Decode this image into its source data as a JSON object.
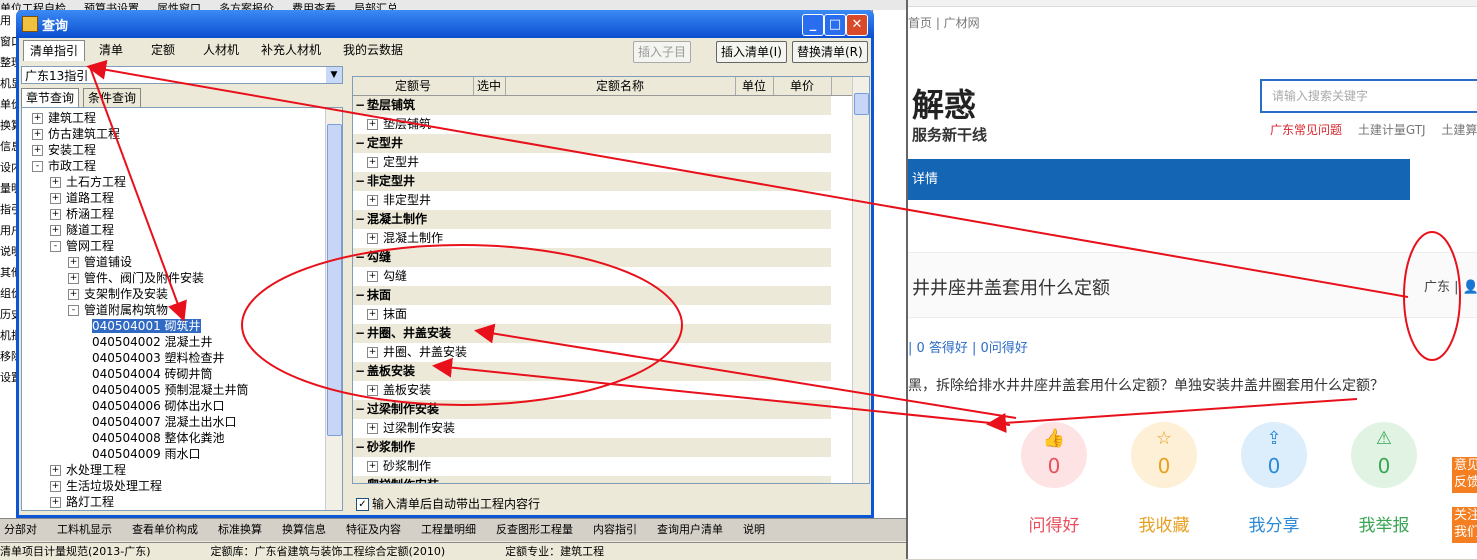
{
  "bg_app": {
    "toolbar_items": [
      "单位工程自检",
      "预算书设置",
      "属性窗口",
      "多方案报价",
      "费用查看",
      "局部汇总"
    ],
    "left_col_chars": [
      "用",
      "窗口",
      "整理",
      "机显",
      "单价",
      "换算",
      "信息",
      "设内",
      "量明",
      "指引",
      "用户",
      "说明",
      "其他",
      "组价",
      "历史",
      "机批",
      "移除",
      "设置"
    ],
    "bottom_tabs": [
      "分部对",
      "工料机显示",
      "查看单价构成",
      "标准换算",
      "换算信息",
      "特征及内容",
      "工程量明细",
      "反查图形工程量",
      "内容指引",
      "查询用户清单",
      "说明"
    ],
    "status": [
      "清单项目计量规范(2013-广东)",
      "定额库：广东省建筑与装饰工程综合定额(2010)",
      "定额专业：建筑工程"
    ]
  },
  "dialog": {
    "title": "查询",
    "tabs": [
      "清单指引",
      "清单",
      "定额",
      "人材机",
      "补充人材机",
      "我的云数据"
    ],
    "buttons": {
      "insert_child": "插入子目",
      "insert_list": "插入清单(I)",
      "replace_list": "替换清单(R)"
    },
    "select_value": "广东13指引",
    "subtabs": [
      "章节查询",
      "条件查询"
    ],
    "tree": [
      {
        "label": "建筑工程",
        "level": 0,
        "exp": "+"
      },
      {
        "label": "仿古建筑工程",
        "level": 0,
        "exp": "+"
      },
      {
        "label": "安装工程",
        "level": 0,
        "exp": "+"
      },
      {
        "label": "市政工程",
        "level": 0,
        "exp": "-"
      },
      {
        "label": "土石方工程",
        "level": 1,
        "exp": "+"
      },
      {
        "label": "道路工程",
        "level": 1,
        "exp": "+"
      },
      {
        "label": "桥涵工程",
        "level": 1,
        "exp": "+"
      },
      {
        "label": "隧道工程",
        "level": 1,
        "exp": "+"
      },
      {
        "label": "管网工程",
        "level": 1,
        "exp": "-"
      },
      {
        "label": "管道铺设",
        "level": 2,
        "exp": "+"
      },
      {
        "label": "管件、阀门及附件安装",
        "level": 2,
        "exp": "+"
      },
      {
        "label": "支架制作及安装",
        "level": 2,
        "exp": "+"
      },
      {
        "label": "管道附属构筑物",
        "level": 2,
        "exp": "-"
      },
      {
        "label": "040504001  砌筑井",
        "level": 3,
        "exp": "",
        "selected": true
      },
      {
        "label": "040504002  混凝土井",
        "level": 3,
        "exp": ""
      },
      {
        "label": "040504003  塑料检查井",
        "level": 3,
        "exp": ""
      },
      {
        "label": "040504004  砖砌井筒",
        "level": 3,
        "exp": ""
      },
      {
        "label": "040504005  预制混凝土井筒",
        "level": 3,
        "exp": ""
      },
      {
        "label": "040504006  砌体出水口",
        "level": 3,
        "exp": ""
      },
      {
        "label": "040504007  混凝土出水口",
        "level": 3,
        "exp": ""
      },
      {
        "label": "040504008  整体化粪池",
        "level": 3,
        "exp": ""
      },
      {
        "label": "040504009  雨水口",
        "level": 3,
        "exp": ""
      },
      {
        "label": "水处理工程",
        "level": 1,
        "exp": "+"
      },
      {
        "label": "生活垃圾处理工程",
        "level": 1,
        "exp": "+"
      },
      {
        "label": "路灯工程",
        "level": 1,
        "exp": "+"
      }
    ],
    "grid_headers": [
      "定额号",
      "选中",
      "定额名称",
      "单位",
      "单价"
    ],
    "grid_rows": [
      {
        "type": "group",
        "label": "垫层铺筑"
      },
      {
        "type": "child",
        "label": "垫层铺筑"
      },
      {
        "type": "group",
        "label": "定型井"
      },
      {
        "type": "child",
        "label": "定型井"
      },
      {
        "type": "group",
        "label": "非定型井"
      },
      {
        "type": "child",
        "label": "非定型井"
      },
      {
        "type": "group",
        "label": "混凝土制作"
      },
      {
        "type": "child",
        "label": "混凝土制作"
      },
      {
        "type": "group",
        "label": "勾缝"
      },
      {
        "type": "child",
        "label": "勾缝"
      },
      {
        "type": "group",
        "label": "抹面"
      },
      {
        "type": "child",
        "label": "抹面"
      },
      {
        "type": "group",
        "label": "井圈、井盖安装"
      },
      {
        "type": "child",
        "label": "井圈、井盖安装"
      },
      {
        "type": "group",
        "label": "盖板安装"
      },
      {
        "type": "child",
        "label": "盖板安装"
      },
      {
        "type": "group",
        "label": "过梁制作安装"
      },
      {
        "type": "child",
        "label": "过梁制作安装"
      },
      {
        "type": "group",
        "label": "砂浆制作"
      },
      {
        "type": "child",
        "label": "砂浆制作"
      },
      {
        "type": "group",
        "label": "爬梯制作安装"
      }
    ],
    "checkbox_label": "输入清单后自动带出工程内容行",
    "checkbox_checked": true
  },
  "web": {
    "breadcrumb": "首页  |  广材网",
    "logo_main": "解惑",
    "logo_sub": "服务新干线",
    "search_placeholder": "请输入搜索关键字",
    "hot_links": [
      "广东常见问题",
      "土建计量GTJ",
      "土建算"
    ],
    "nav_text": "详情",
    "question_title": "井井座井盖套用什么定额",
    "region": "广东",
    "stats": "| 0 答得好 | 0问得好",
    "question_text": "黑，拆除给排水井井座井盖套用什么定额？单独安装井盖井圈套用什么定额？",
    "actions": [
      {
        "label": "问得好",
        "count": "0",
        "icon": "thumbs-up",
        "color": "#e8505b",
        "bg": "#fde3e4"
      },
      {
        "label": "我收藏",
        "count": "0",
        "icon": "star",
        "color": "#e8a020",
        "bg": "#fdf0d6"
      },
      {
        "label": "我分享",
        "count": "0",
        "icon": "share",
        "color": "#2b8ad8",
        "bg": "#dcedfb"
      },
      {
        "label": "我举报",
        "count": "0",
        "icon": "warning",
        "color": "#3aa655",
        "bg": "#e1f4e4"
      }
    ],
    "side_tags": [
      "意见反馈",
      "关注我们"
    ]
  },
  "colors": {
    "annotation": "#e8101a"
  }
}
